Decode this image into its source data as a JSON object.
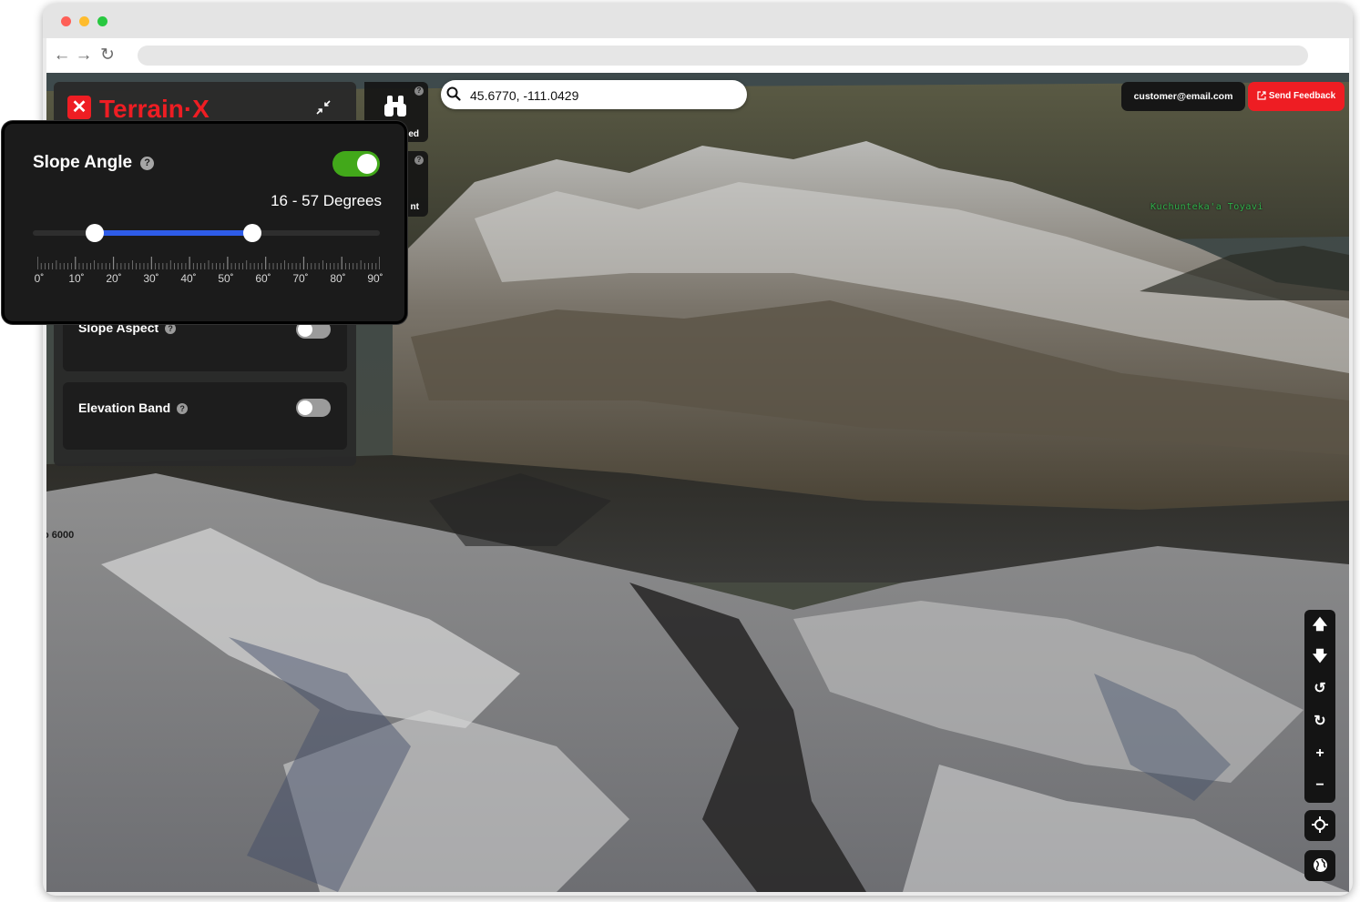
{
  "browser": {
    "traffic_lights": [
      "#fe5f57",
      "#febc2e",
      "#28c840"
    ],
    "nav_icons": [
      "back-arrow-icon",
      "forward-arrow-icon",
      "reload-icon"
    ],
    "url": ""
  },
  "app": {
    "logo_mark": "✕",
    "logo_text": "Terrain·X",
    "brand_color": "#ee1d23",
    "collapse_icon": "collapse-arrows-icon"
  },
  "search": {
    "icon": "search-icon",
    "value": "45.6770, -111.0429",
    "placeholder": ""
  },
  "header": {
    "user_email": "customer@email.com",
    "feedback_label": "Send Feedback",
    "feedback_icon": "external-link-icon"
  },
  "layers_panel": {
    "cards": [
      {
        "title": "Slope Aspect",
        "help": "?",
        "enabled": false
      },
      {
        "title": "Elevation Band",
        "help": "?",
        "enabled": false
      }
    ]
  },
  "tools": [
    {
      "icon": "binoculars-icon",
      "label_fragment": "ed",
      "help": "?"
    },
    {
      "icon": "tool-icon",
      "label_fragment": "nt",
      "help": "?"
    }
  ],
  "slope_popup": {
    "title": "Slope Angle",
    "help": "?",
    "enabled": true,
    "accent": "#42a81a",
    "range_label": "16 - 57 Degrees",
    "range": {
      "min": 0,
      "max": 90,
      "low": 16,
      "high": 57
    },
    "fill_color": "#2e5ce8",
    "tick_labels": [
      "0˚",
      "10˚",
      "20˚",
      "30˚",
      "40˚",
      "50˚",
      "60˚",
      "70˚",
      "80˚",
      "90˚"
    ]
  },
  "map": {
    "labels": [
      "Kuchunteka'a Toyavi",
      "o 6000"
    ]
  },
  "map_controls": {
    "buttons": [
      {
        "name": "pan-up-button",
        "icon": "arrow-up-icon",
        "glyph": "🡅"
      },
      {
        "name": "pan-down-button",
        "icon": "arrow-down-icon",
        "glyph": "🡇"
      },
      {
        "name": "rotate-left-button",
        "icon": "rotate-left-icon",
        "glyph": "↺"
      },
      {
        "name": "rotate-right-button",
        "icon": "rotate-right-icon",
        "glyph": "↻"
      },
      {
        "name": "zoom-in-button",
        "icon": "plus-icon",
        "glyph": "+"
      },
      {
        "name": "zoom-out-button",
        "icon": "minus-icon",
        "glyph": "−"
      }
    ],
    "locate_icon": "crosshair-icon",
    "globe_icon": "globe-icon"
  }
}
